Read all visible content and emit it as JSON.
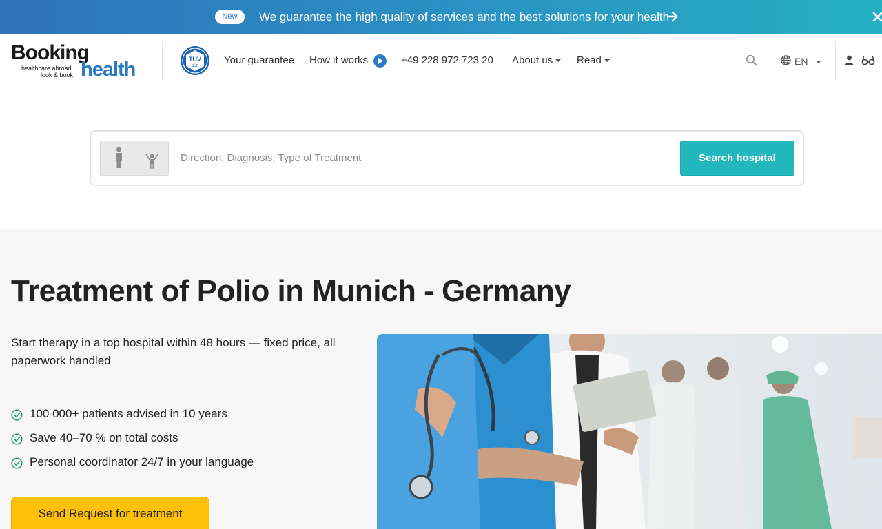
{
  "banner": {
    "badge": "New",
    "message": "We guarantee the high quality of services and the best solutions for your health",
    "arrow_icon": "arrow-right-icon",
    "close_icon": "close-icon"
  },
  "logo": {
    "word1": "Booking",
    "word2": "health",
    "tagline_line1": "healthcare abroad",
    "tagline_line2": "look & book"
  },
  "certificate": {
    "line1": "TÜV",
    "line2": "SÜD"
  },
  "nav": {
    "your_guarantee": "Your guarantee",
    "how_it_works": "How it works",
    "phone": "+49 228 972 723 20",
    "about_us": "About us",
    "read": "Read",
    "language": "EN"
  },
  "search": {
    "placeholder": "Direction, Diagnosis, Type of Treatment",
    "value": "",
    "button_label": "Search hospital",
    "toggle_options": [
      "adult",
      "child"
    ]
  },
  "main": {
    "title": "Treatment of Polio in Munich - Germany",
    "subtitle": "Start therapy in a top hospital within 48 hours — fixed price, all paperwork handled",
    "benefits": [
      "100 000+ patients advised in 10 years",
      "Save 40–70 % on total costs",
      "Personal coordinator 24/7 in your language"
    ],
    "cta_label": "Send Request for treatment"
  },
  "colors": {
    "banner_start": "#2f73b8",
    "banner_end": "#25b0c2",
    "brand_blue": "#2a7bc0",
    "search_button": "#22b8bd",
    "cta": "#ffc107",
    "check": "#2fa36b"
  }
}
